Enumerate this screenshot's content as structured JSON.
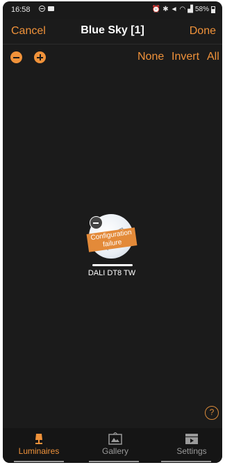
{
  "status_bar": {
    "time": "16:58",
    "battery": "58%"
  },
  "nav": {
    "cancel_label": "Cancel",
    "title": "Blue Sky [1]",
    "done_label": "Done"
  },
  "toolbar": {
    "none_label": "None",
    "invert_label": "Invert",
    "all_label": "All"
  },
  "luminaire": {
    "status_line1": "Configuration",
    "status_line2": "failure",
    "name": "DALI DT8 TW"
  },
  "help": {
    "label": "?"
  },
  "tabs": [
    {
      "label": "Luminaires",
      "icon": "lamp-icon",
      "active": true
    },
    {
      "label": "Gallery",
      "icon": "gallery-icon",
      "active": false
    },
    {
      "label": "Settings",
      "icon": "clapperboard-icon",
      "active": false
    }
  ],
  "colors": {
    "accent": "#f0923a",
    "background": "#1b1b1b",
    "ribbon": "#e38a39"
  }
}
